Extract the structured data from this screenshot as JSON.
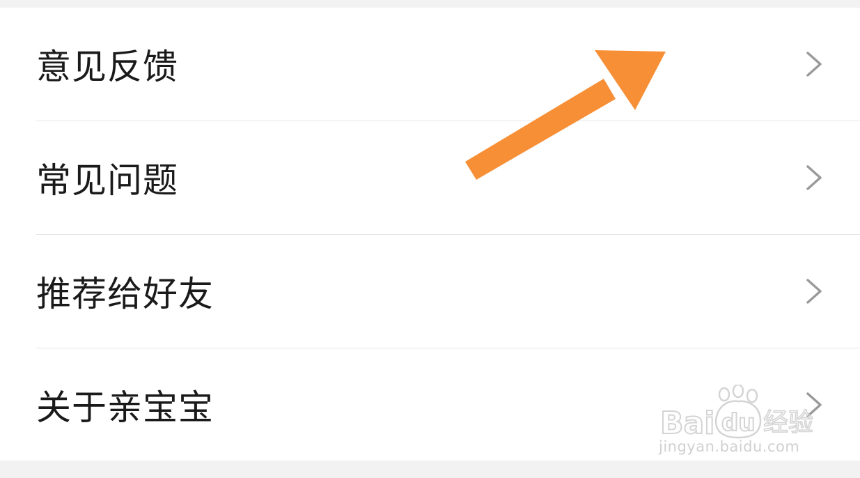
{
  "menu": {
    "items": [
      {
        "label": "意见反馈"
      },
      {
        "label": "常见问题"
      },
      {
        "label": "推荐给好友"
      },
      {
        "label": "关于亲宝宝"
      }
    ]
  },
  "annotation": {
    "arrow_color": "#f78f36"
  },
  "watermark": {
    "logo_text": "Bai du 经验",
    "url": "jingyan.baidu.com"
  },
  "colors": {
    "background": "#f2f2f2",
    "card": "#ffffff",
    "text": "#1a1a1a",
    "divider": "#e6e6e6",
    "chevron": "#9a9a9a"
  }
}
